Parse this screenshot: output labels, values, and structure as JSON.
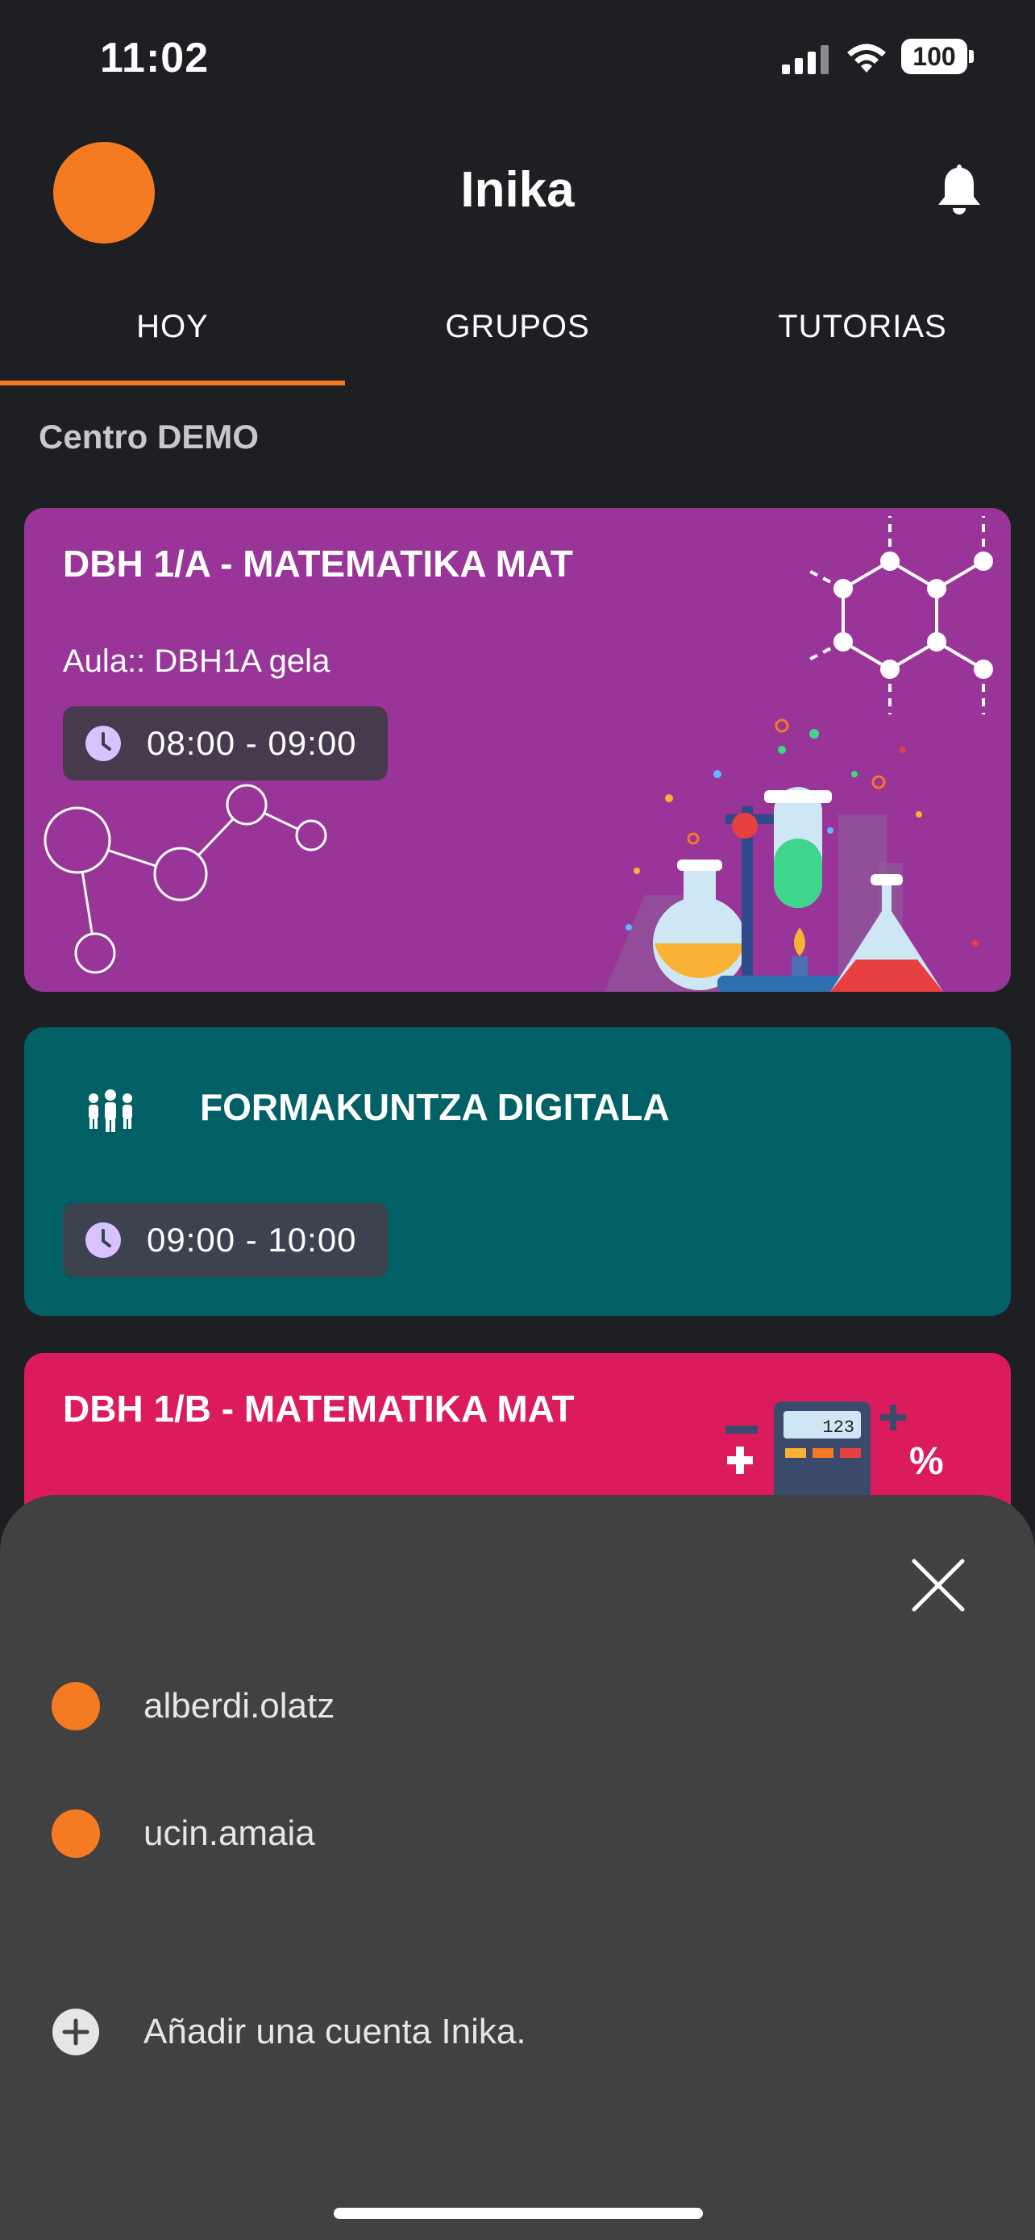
{
  "status_bar": {
    "time": "11:02",
    "battery": "100"
  },
  "header": {
    "title": "Inika"
  },
  "tabs": [
    {
      "label": "HOY",
      "active": true
    },
    {
      "label": "GRUPOS",
      "active": false
    },
    {
      "label": "TUTORIAS",
      "active": false
    }
  ],
  "section": {
    "title": "Centro DEMO"
  },
  "classes": [
    {
      "title": "DBH 1/A - MATEMATIKA MAT",
      "room": "Aula:: DBH1A gela",
      "time": "08:00 - 09:00",
      "color": "#993598"
    },
    {
      "title": "FORMAKUNTZA DIGITALA",
      "time": "09:00 - 10:00",
      "color": "#006066"
    },
    {
      "title": "DBH 1/B - MATEMATIKA MAT",
      "calc_display": "123",
      "color": "#db1b5b"
    }
  ],
  "account_sheet": {
    "accounts": [
      {
        "name": "alberdi.olatz"
      },
      {
        "name": "ucin.amaia"
      }
    ],
    "add_account_label": "Añadir una cuenta Inika."
  },
  "colors": {
    "accent": "#f47b22",
    "background": "#1e1f23",
    "sheet": "#414141"
  },
  "icons": [
    "bell-icon",
    "clock-icon",
    "people-icon",
    "close-icon",
    "plus-circle-icon"
  ]
}
